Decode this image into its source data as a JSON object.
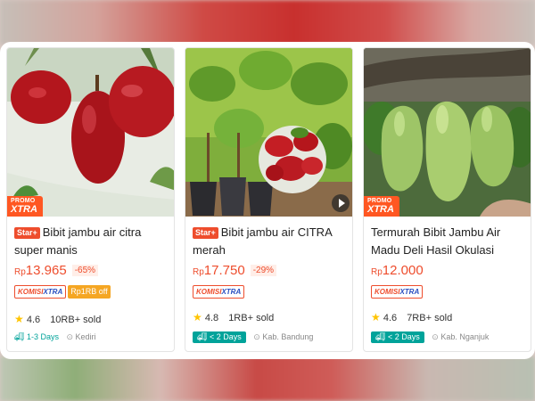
{
  "promo_label_top": "PROMO",
  "promo_label_bottom": "XTRA",
  "star_badge": "Star+",
  "currency": "Rp",
  "komisi_left": "KOMISI",
  "komisi_right": "XTRA",
  "colors": {
    "accent": "#ee4d2d",
    "shipping": "#00a39a",
    "rating_star": "#ffc400",
    "komisi_off": "#f5a623"
  },
  "products": [
    {
      "title": "Bibit jambu air citra super manis",
      "has_star_badge": true,
      "price": "13.965",
      "discount": "-65%",
      "komisi_off": "Rp1RB off",
      "rating": "4.6",
      "sold": "10RB+ sold",
      "delivery": "1-3 Days",
      "location": "Kediri",
      "image_icon": "red-rose-apple-image"
    },
    {
      "title": "Bibit jambu air CITRA merah",
      "has_star_badge": true,
      "price": "17.750",
      "discount": "-29%",
      "rating": "4.8",
      "sold": "1RB+ sold",
      "delivery": "< 2 Days",
      "location": "Kab. Bandung",
      "image_icon": "seedlings-video-image"
    },
    {
      "title": "Termurah Bibit Jambu Air Madu Deli Hasil Okulasi",
      "has_star_badge": false,
      "price": "12.000",
      "rating": "4.6",
      "sold": "7RB+ sold",
      "delivery": "< 2 Days",
      "location": "Kab. Nganjuk",
      "image_icon": "green-rose-apple-image"
    }
  ]
}
